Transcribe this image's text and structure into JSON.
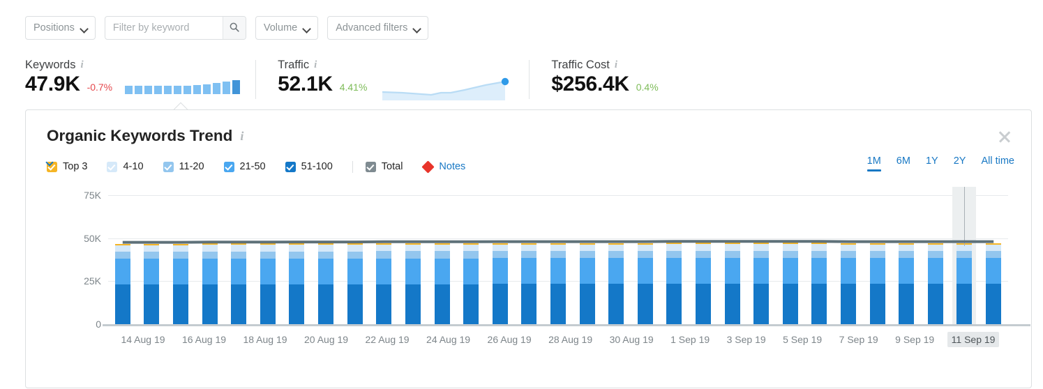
{
  "filters": {
    "positions_label": "Positions",
    "keyword_placeholder": "Filter by keyword",
    "keyword_value": "",
    "search_icon": "search-icon",
    "volume_label": "Volume",
    "advanced_label": "Advanced filters"
  },
  "metrics": [
    {
      "label": "Keywords",
      "value": "47.9K",
      "delta": "-0.7%",
      "delta_dir": "neg",
      "viz": "bars"
    },
    {
      "label": "Traffic",
      "value": "52.1K",
      "delta": "4.41%",
      "delta_dir": "pos",
      "viz": "line"
    },
    {
      "label": "Traffic Cost",
      "value": "$256.4K",
      "delta": "0.4%",
      "delta_dir": "pos",
      "viz": "none"
    }
  ],
  "metric_spark_bars": [
    12,
    12,
    12,
    12,
    12,
    12,
    12,
    13,
    14,
    16,
    18,
    20
  ],
  "panel": {
    "title": "Organic Keywords Trend",
    "close_icon": "close-icon",
    "notes_label": "Notes",
    "notes_marker_color": "#e8342a",
    "legend": [
      {
        "label": "Top 3",
        "color": "#f5b525",
        "checked": true
      },
      {
        "label": "4-10",
        "color": "#d6e9f9",
        "checked": true
      },
      {
        "label": "11-20",
        "color": "#93c6ee",
        "checked": true
      },
      {
        "label": "21-50",
        "color": "#4aa7f0",
        "checked": true
      },
      {
        "label": "51-100",
        "color": "#1478c8",
        "checked": true
      },
      {
        "label": "Total",
        "color": "#7f8b91",
        "checked": true
      }
    ],
    "ranges": [
      {
        "label": "1M",
        "active": true
      },
      {
        "label": "6M",
        "active": false
      },
      {
        "label": "1Y",
        "active": false
      },
      {
        "label": "2Y",
        "active": false
      },
      {
        "label": "All time",
        "active": false
      }
    ],
    "active_range": "1M",
    "hovered_date": "11 Sep 19"
  },
  "chart_data": {
    "type": "bar",
    "stacked": true,
    "title": "Organic Keywords Trend",
    "xlabel": "",
    "ylabel": "",
    "ylim": [
      0,
      75000
    ],
    "yticks": [
      0,
      25000,
      50000,
      75000
    ],
    "ytick_labels": [
      "0",
      "25K",
      "50K",
      "75K"
    ],
    "grid": true,
    "legend_position": "top-left",
    "accent_color": "#1878c4",
    "categories": [
      "13 Aug 19",
      "14 Aug 19",
      "15 Aug 19",
      "16 Aug 19",
      "17 Aug 19",
      "18 Aug 19",
      "19 Aug 19",
      "20 Aug 19",
      "21 Aug 19",
      "22 Aug 19",
      "23 Aug 19",
      "24 Aug 19",
      "25 Aug 19",
      "26 Aug 19",
      "27 Aug 19",
      "28 Aug 19",
      "29 Aug 19",
      "30 Aug 19",
      "31 Aug 19",
      "1 Sep 19",
      "2 Sep 19",
      "3 Sep 19",
      "4 Sep 19",
      "5 Sep 19",
      "6 Sep 19",
      "7 Sep 19",
      "8 Sep 19",
      "9 Sep 19",
      "10 Sep 19",
      "11 Sep 19",
      "12 Sep 19"
    ],
    "tick_labels_shown": [
      "14 Aug 19",
      "16 Aug 19",
      "18 Aug 19",
      "20 Aug 19",
      "22 Aug 19",
      "24 Aug 19",
      "26 Aug 19",
      "28 Aug 19",
      "30 Aug 19",
      "1 Sep 19",
      "3 Sep 19",
      "5 Sep 19",
      "7 Sep 19",
      "9 Sep 19",
      "11 Sep 19"
    ],
    "series": [
      {
        "name": "51-100",
        "color": "#1478c8",
        "values": [
          23000,
          23000,
          23000,
          23100,
          23100,
          23100,
          23200,
          23200,
          23200,
          23300,
          23300,
          23300,
          23300,
          23400,
          23400,
          23400,
          23400,
          23400,
          23400,
          23500,
          23500,
          23500,
          23500,
          23500,
          23500,
          23400,
          23400,
          23400,
          23400,
          23400,
          23400
        ]
      },
      {
        "name": "21-50",
        "color": "#4aa7f0",
        "values": [
          15000,
          15000,
          15000,
          15000,
          15000,
          15000,
          15000,
          15000,
          15000,
          15000,
          15000,
          15000,
          15000,
          15000,
          15000,
          15000,
          15000,
          15000,
          15000,
          15000,
          15000,
          15000,
          15000,
          15000,
          15000,
          15000,
          15000,
          15000,
          15000,
          15000,
          15000
        ]
      },
      {
        "name": "11-20",
        "color": "#93c6ee",
        "values": [
          4100,
          4100,
          4100,
          4100,
          4100,
          4100,
          4100,
          4100,
          4100,
          4100,
          4100,
          4100,
          4100,
          4100,
          4100,
          4100,
          4100,
          4100,
          4100,
          4100,
          4100,
          4100,
          4100,
          4100,
          4100,
          4100,
          4100,
          4100,
          4100,
          4100,
          4100
        ]
      },
      {
        "name": "4-10",
        "color": "#d6e9f9",
        "values": [
          3900,
          3900,
          3900,
          3900,
          3900,
          3900,
          3900,
          3900,
          3900,
          3900,
          3900,
          3900,
          3900,
          3900,
          3900,
          3900,
          3900,
          3900,
          3900,
          3900,
          3900,
          3900,
          3900,
          3900,
          3900,
          3900,
          3900,
          3900,
          3900,
          3900,
          3900
        ]
      },
      {
        "name": "Top 3",
        "color": "#f5b525",
        "values": [
          800,
          800,
          800,
          800,
          800,
          800,
          800,
          800,
          800,
          800,
          800,
          800,
          800,
          800,
          800,
          800,
          800,
          800,
          800,
          800,
          800,
          800,
          800,
          800,
          800,
          800,
          800,
          800,
          800,
          800,
          800
        ]
      },
      {
        "name": "Total",
        "color": "#5e7179",
        "type": "line",
        "values": [
          46800,
          46800,
          46800,
          46900,
          46900,
          46900,
          47000,
          47000,
          47000,
          47100,
          47100,
          47100,
          47100,
          47200,
          47200,
          47200,
          47200,
          47200,
          47200,
          47300,
          47300,
          47300,
          47300,
          47300,
          47300,
          47200,
          47200,
          47200,
          47200,
          47200,
          47200
        ]
      }
    ]
  }
}
